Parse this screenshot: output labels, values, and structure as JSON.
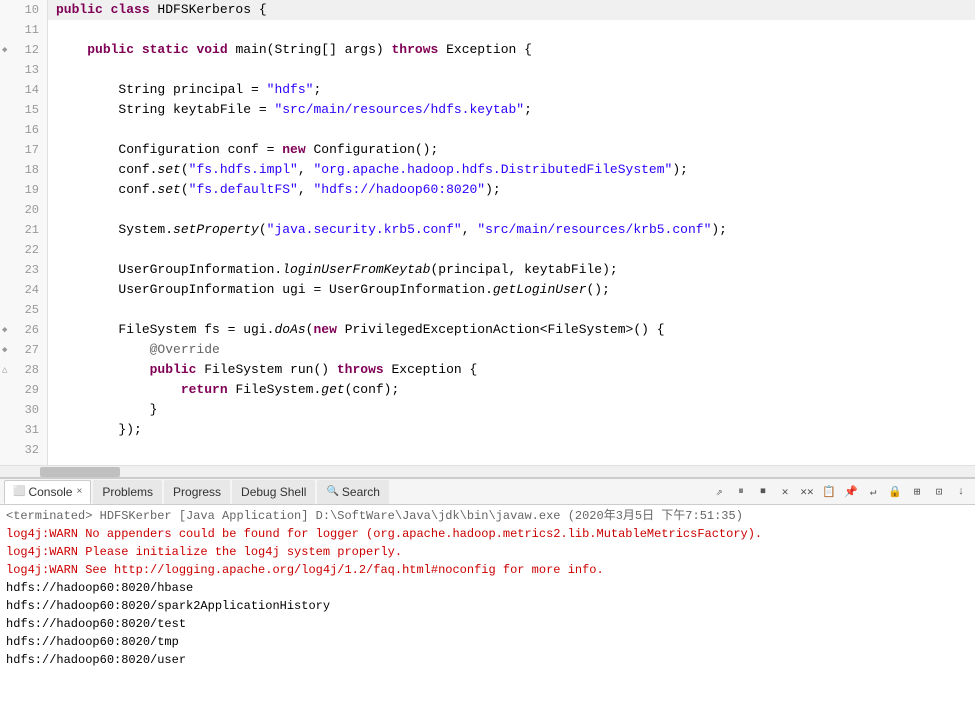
{
  "code": {
    "lines": [
      {
        "num": "10",
        "fold": "",
        "tokens": [
          {
            "t": "public ",
            "c": "kw"
          },
          {
            "t": "class ",
            "c": "kw"
          },
          {
            "t": "HDFSKerberos {",
            "c": "plain"
          }
        ]
      },
      {
        "num": "11",
        "fold": "",
        "tokens": [
          {
            "t": "",
            "c": "plain"
          }
        ]
      },
      {
        "num": "12",
        "fold": "◆",
        "tokens": [
          {
            "t": "    ",
            "c": "plain"
          },
          {
            "t": "public ",
            "c": "kw"
          },
          {
            "t": "static ",
            "c": "kw"
          },
          {
            "t": "void ",
            "c": "kw"
          },
          {
            "t": "main(String[] args) ",
            "c": "plain"
          },
          {
            "t": "throws ",
            "c": "throws-kw"
          },
          {
            "t": "Exception {",
            "c": "plain"
          }
        ]
      },
      {
        "num": "13",
        "fold": "",
        "tokens": [
          {
            "t": "",
            "c": "plain"
          }
        ]
      },
      {
        "num": "14",
        "fold": "",
        "tokens": [
          {
            "t": "        String principal = ",
            "c": "plain"
          },
          {
            "t": "\"hdfs\"",
            "c": "str"
          },
          {
            "t": ";",
            "c": "plain"
          }
        ]
      },
      {
        "num": "15",
        "fold": "",
        "tokens": [
          {
            "t": "        String keytabFile = ",
            "c": "plain"
          },
          {
            "t": "\"src/main/resources/hdfs.keytab\"",
            "c": "str"
          },
          {
            "t": ";",
            "c": "plain"
          }
        ]
      },
      {
        "num": "16",
        "fold": "",
        "tokens": [
          {
            "t": "",
            "c": "plain"
          }
        ]
      },
      {
        "num": "17",
        "fold": "",
        "tokens": [
          {
            "t": "        Configuration conf = ",
            "c": "plain"
          },
          {
            "t": "new ",
            "c": "kw"
          },
          {
            "t": "Configuration();",
            "c": "plain"
          }
        ]
      },
      {
        "num": "18",
        "fold": "",
        "tokens": [
          {
            "t": "        conf.",
            "c": "plain"
          },
          {
            "t": "set",
            "c": "method"
          },
          {
            "t": "(",
            "c": "plain"
          },
          {
            "t": "\"fs.hdfs.impl\"",
            "c": "str"
          },
          {
            "t": ", ",
            "c": "plain"
          },
          {
            "t": "\"org.apache.hadoop.hdfs.DistributedFileSystem\"",
            "c": "str"
          },
          {
            "t": ");",
            "c": "plain"
          }
        ]
      },
      {
        "num": "19",
        "fold": "",
        "tokens": [
          {
            "t": "        conf.",
            "c": "plain"
          },
          {
            "t": "set",
            "c": "method"
          },
          {
            "t": "(",
            "c": "plain"
          },
          {
            "t": "\"fs.defaultFS\"",
            "c": "str"
          },
          {
            "t": ", ",
            "c": "plain"
          },
          {
            "t": "\"hdfs://hadoop60:8020\"",
            "c": "str"
          },
          {
            "t": ");",
            "c": "plain"
          }
        ]
      },
      {
        "num": "20",
        "fold": "",
        "tokens": [
          {
            "t": "",
            "c": "plain"
          }
        ]
      },
      {
        "num": "21",
        "fold": "",
        "tokens": [
          {
            "t": "        System.",
            "c": "plain"
          },
          {
            "t": "setProperty",
            "c": "method"
          },
          {
            "t": "(",
            "c": "plain"
          },
          {
            "t": "\"java.security.krb5.conf\"",
            "c": "str"
          },
          {
            "t": ", ",
            "c": "plain"
          },
          {
            "t": "\"src/main/resources/krb5.conf\"",
            "c": "str"
          },
          {
            "t": ");",
            "c": "plain"
          }
        ]
      },
      {
        "num": "22",
        "fold": "",
        "tokens": [
          {
            "t": "",
            "c": "plain"
          }
        ]
      },
      {
        "num": "23",
        "fold": "",
        "tokens": [
          {
            "t": "        UserGroupInformation.",
            "c": "plain"
          },
          {
            "t": "loginUserFromKeytab",
            "c": "method"
          },
          {
            "t": "(principal, keytabFile);",
            "c": "plain"
          }
        ]
      },
      {
        "num": "24",
        "fold": "",
        "tokens": [
          {
            "t": "        UserGroupInformation ugi = UserGroupInformation.",
            "c": "plain"
          },
          {
            "t": "getLoginUser",
            "c": "method"
          },
          {
            "t": "();",
            "c": "plain"
          }
        ]
      },
      {
        "num": "25",
        "fold": "",
        "tokens": [
          {
            "t": "",
            "c": "plain"
          }
        ]
      },
      {
        "num": "26",
        "fold": "◆",
        "tokens": [
          {
            "t": "        FileSystem fs = ugi.",
            "c": "plain"
          },
          {
            "t": "doAs",
            "c": "method"
          },
          {
            "t": "(",
            "c": "plain"
          },
          {
            "t": "new ",
            "c": "kw"
          },
          {
            "t": "PrivilegedExceptionAction<FileSystem>() {",
            "c": "plain"
          }
        ]
      },
      {
        "num": "27",
        "fold": "◆",
        "tokens": [
          {
            "t": "            ",
            "c": "plain"
          },
          {
            "t": "@Override",
            "c": "annotation"
          }
        ]
      },
      {
        "num": "28",
        "fold": "△",
        "tokens": [
          {
            "t": "            ",
            "c": "plain"
          },
          {
            "t": "public ",
            "c": "kw"
          },
          {
            "t": "FileSystem run() ",
            "c": "plain"
          },
          {
            "t": "throws ",
            "c": "throws-kw"
          },
          {
            "t": "Exception {",
            "c": "plain"
          }
        ]
      },
      {
        "num": "29",
        "fold": "",
        "tokens": [
          {
            "t": "                ",
            "c": "plain"
          },
          {
            "t": "return ",
            "c": "kw"
          },
          {
            "t": "FileSystem.",
            "c": "plain"
          },
          {
            "t": "get",
            "c": "method"
          },
          {
            "t": "(conf);",
            "c": "plain"
          }
        ]
      },
      {
        "num": "30",
        "fold": "",
        "tokens": [
          {
            "t": "            }",
            "c": "plain"
          }
        ]
      },
      {
        "num": "31",
        "fold": "",
        "tokens": [
          {
            "t": "        });",
            "c": "plain"
          }
        ]
      },
      {
        "num": "32",
        "fold": "",
        "tokens": [
          {
            "t": "",
            "c": "plain"
          }
        ]
      },
      {
        "num": "...",
        "fold": "",
        "tokens": [
          {
            "t": "",
            "c": "plain"
          }
        ]
      }
    ]
  },
  "console": {
    "tabs": [
      {
        "id": "console",
        "label": "Console",
        "icon": "⬛",
        "active": true,
        "closable": true
      },
      {
        "id": "problems",
        "label": "Problems",
        "active": false,
        "closable": false
      },
      {
        "id": "progress",
        "label": "Progress",
        "active": false,
        "closable": false
      },
      {
        "id": "debug-shell",
        "label": "Debug Shell",
        "active": false,
        "closable": false
      },
      {
        "id": "search",
        "label": "Search",
        "icon": "🔍",
        "active": false,
        "closable": false
      }
    ],
    "toolbar_buttons": [
      "⟳",
      "⏸",
      "⏹",
      "⏹⏹",
      "✂",
      "📋",
      "📋⬛",
      "🔲",
      "↕",
      "→"
    ],
    "terminated_line": "<terminated> HDFSKerber [Java Application] D:\\SoftWare\\Java\\jdk\\bin\\javaw.exe (2020年3月5日 下午7:51:35)",
    "output_lines": [
      {
        "text": "log4j:WARN No appenders could be found for logger (org.apache.hadoop.metrics2.lib.MutableMetricsFactory).",
        "type": "warn"
      },
      {
        "text": "log4j:WARN Please initialize the log4j system properly.",
        "type": "warn"
      },
      {
        "text": "log4j:WARN See http://logging.apache.org/log4j/1.2/faq.html#noconfig for more info.",
        "type": "warn"
      },
      {
        "text": "hdfs://hadoop60:8020/hbase",
        "type": "normal"
      },
      {
        "text": "hdfs://hadoop60:8020/spark2ApplicationHistory",
        "type": "normal"
      },
      {
        "text": "hdfs://hadoop60:8020/test",
        "type": "normal"
      },
      {
        "text": "hdfs://hadoop60:8020/tmp",
        "type": "normal"
      },
      {
        "text": "hdfs://hadoop60:8020/user",
        "type": "normal"
      }
    ]
  }
}
